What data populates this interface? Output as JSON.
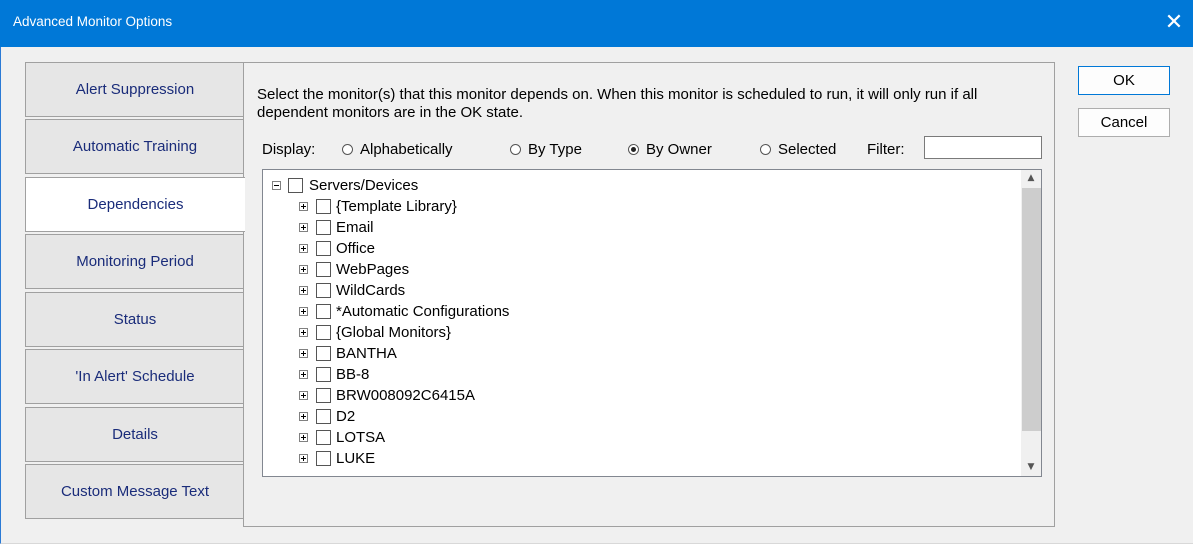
{
  "window": {
    "title": "Advanced Monitor Options",
    "close_glyph": "✕"
  },
  "tabs": [
    {
      "label": "Alert Suppression"
    },
    {
      "label": "Automatic Training"
    },
    {
      "label": "Dependencies",
      "active": true
    },
    {
      "label": "Monitoring Period"
    },
    {
      "label": "Status"
    },
    {
      "label": "'In Alert' Schedule"
    },
    {
      "label": "Details"
    },
    {
      "label": "Custom Message Text"
    }
  ],
  "panel": {
    "description": "Select the monitor(s) that this monitor depends on.  When this monitor is scheduled to run, it will only run if all dependent monitors  are in the OK state.",
    "display_label": "Display:",
    "options": [
      {
        "label": "Alphabetically",
        "selected": false
      },
      {
        "label": "By Type",
        "selected": false
      },
      {
        "label": "By Owner",
        "selected": true
      },
      {
        "label": "Selected",
        "selected": false
      }
    ],
    "filter_label": "Filter:",
    "filter_value": ""
  },
  "tree": {
    "root": {
      "label": "Servers/Devices",
      "expanded": true,
      "checked": false
    },
    "children": [
      {
        "label": "{Template Library}"
      },
      {
        "label": "Email"
      },
      {
        "label": "Office"
      },
      {
        "label": "WebPages"
      },
      {
        "label": "WildCards"
      },
      {
        "label": "*Automatic Configurations"
      },
      {
        "label": "{Global Monitors}"
      },
      {
        "label": "BANTHA"
      },
      {
        "label": "BB-8"
      },
      {
        "label": "BRW008092C6415A"
      },
      {
        "label": "D2"
      },
      {
        "label": "LOTSA"
      },
      {
        "label": "LUKE"
      }
    ]
  },
  "buttons": {
    "ok": "OK",
    "cancel": "Cancel"
  },
  "icons": {
    "scroll_up": "chevron-up-icon",
    "scroll_down": "chevron-down-icon"
  }
}
